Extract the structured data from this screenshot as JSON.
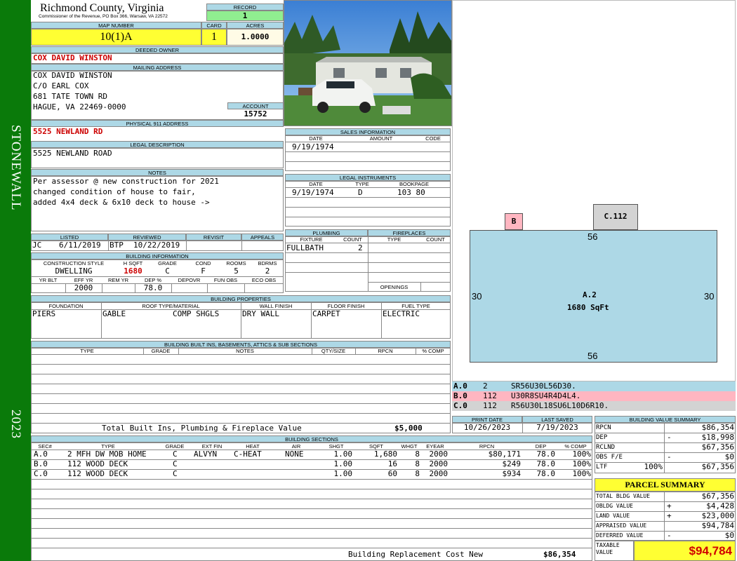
{
  "sidebar": {
    "district": "STONEWALL",
    "year": "2023"
  },
  "header": {
    "county": "Richmond County, Virginia",
    "address": "Commissioner of the Revenue, PO Box 366, Warsaw, VA 22572",
    "record_label": "RECORD",
    "record": "1"
  },
  "map": {
    "map_label": "MAP NUMBER",
    "map_number": "10(1)A",
    "card_label": "CARD",
    "card": "1",
    "acres_label": "ACRES",
    "acres": "1.0000"
  },
  "owner": {
    "deeded_label": "DEEDED OWNER",
    "deeded": "COX DAVID WINSTON",
    "mailing_label": "MAILING ADDRESS",
    "mailing": [
      "COX DAVID WINSTON",
      "C/O EARL COX",
      "681 TATE TOWN RD",
      "HAGUE, VA 22469-0000"
    ],
    "account_label": "ACCOUNT",
    "account": "15752"
  },
  "physical": {
    "label": "PHYSICAL 911 ADDRESS",
    "value": "5525 NEWLAND RD"
  },
  "legal": {
    "label": "LEGAL DESCRIPTION",
    "value": "5525 NEWLAND ROAD"
  },
  "notes": {
    "label": "NOTES",
    "lines": [
      "Per assessor @ new construction for 2021",
      "changed condition of house to fair,",
      "added 4x4 deck & 6x10 deck to house ->"
    ]
  },
  "listing": {
    "listed_label": "LISTED",
    "listed_by": "JC",
    "listed_date": "6/11/2019",
    "reviewed_label": "REVIEWED",
    "reviewed_by": "BTP",
    "reviewed_date": "10/22/2019",
    "revisit_label": "REVISIT",
    "appeals_label": "APPEALS"
  },
  "building_info": {
    "label": "BUILDING INFORMATION",
    "h": [
      "CONSTRUCTION STYLE",
      "H SQFT",
      "GRADE",
      "COND",
      "ROOMS",
      "BDRMS"
    ],
    "v": [
      "DWELLING",
      "1680",
      "C",
      "F",
      "5",
      "2"
    ],
    "h2": [
      "YR BLT",
      "EFF YR",
      "REM YR",
      "DEP %",
      "DEPOVR",
      "FUN OBS",
      "ECO OBS"
    ],
    "v2": [
      "",
      "2000",
      "",
      "78.0",
      "",
      "",
      ""
    ]
  },
  "sales": {
    "label": "SALES INFORMATION",
    "h": [
      "DATE",
      "AMOUNT",
      "CODE"
    ],
    "date": "9/19/1974"
  },
  "instruments": {
    "label": "LEGAL INSTRUMENTS",
    "h": [
      "DATE",
      "TYPE",
      "BOOKPAGE"
    ],
    "date": "9/19/1974",
    "type": "D",
    "book": "103 80"
  },
  "plumbing": {
    "label": "PLUMBING",
    "h": [
      "FIXTURE",
      "COUNT"
    ],
    "fixture": "FULLBATH",
    "count": "2"
  },
  "fireplaces": {
    "label": "FIREPLACES",
    "h": [
      "TYPE",
      "COUNT"
    ],
    "openings": "OPENINGS"
  },
  "properties": {
    "label": "BUILDING PROPERTIES",
    "h": [
      "FOUNDATION",
      "ROOF TYPE/MATERIAL",
      "WALL FINISH",
      "FLOOR FINISH",
      "FUEL TYPE"
    ],
    "foundation": "PIERS",
    "roof_type": "GABLE",
    "roof_mat": "COMP SHGLS",
    "wall": "DRY WALL",
    "floor": "CARPET",
    "fuel": "ELECTRIC"
  },
  "builtins": {
    "label": "BUILDING BUILT INS, BASEMENTS, ATTICS & SUB SECTIONS",
    "h": [
      "TYPE",
      "GRADE",
      "NOTES",
      "QTY/SIZE",
      "RPCN",
      "% COMP"
    ],
    "total_label": "Total Built Ins, Plumbing & Fireplace Value",
    "total": "$5,000"
  },
  "sections": {
    "label": "BUILDING SECTIONS",
    "h": [
      "SEC#",
      "TYPE",
      "GRADE",
      "EXT FIN",
      "HEAT",
      "AIR",
      "SHGT",
      "SQFT",
      "WHGT",
      "EYEAR",
      "RPCN",
      "DEP",
      "% COMP"
    ],
    "rows": [
      [
        "A.0",
        "2 MFH DW MOB HOME",
        "C",
        "ALVYN",
        "C-HEAT",
        "NONE",
        "1.00",
        "1,680",
        "8",
        "2000",
        "$80,171",
        "78.0",
        "100%"
      ],
      [
        "B.0",
        "112 WOOD DECK",
        "C",
        "",
        "",
        "",
        "1.00",
        "16",
        "8",
        "2000",
        "$249",
        "78.0",
        "100%"
      ],
      [
        "C.0",
        "112 WOOD DECK",
        "C",
        "",
        "",
        "",
        "1.00",
        "60",
        "8",
        "2000",
        "$934",
        "78.0",
        "100%"
      ]
    ],
    "replacement_label": "Building Replacement Cost New",
    "replacement": "$86,354"
  },
  "sketch": {
    "main_label": "A.2",
    "main_area": "1680 SqFt",
    "top": "56",
    "bottom": "56",
    "left": "30",
    "right": "30",
    "deck_b": "B",
    "deck_c": "C.112",
    "legend": [
      {
        "sec": "A.0",
        "code": "2",
        "vectors": "SR56U30L56D30.",
        "color": "#add8e6"
      },
      {
        "sec": "B.0",
        "code": "112",
        "vectors": "U30R8SU4R4D4L4.",
        "color": "#ffb6c1"
      },
      {
        "sec": "C.0",
        "code": "112",
        "vectors": "R56U30L18SU6L10D6R10.",
        "color": "#d3d3d3"
      }
    ]
  },
  "dates": {
    "print_label": "PRINT DATE",
    "print": "10/26/2023",
    "saved_label": "LAST SAVED",
    "saved": "7/19/2023"
  },
  "value_summary": {
    "label": "BUILDING VALUE SUMMARY",
    "rows": [
      {
        "k": "RPCN",
        "op": "",
        "v": "$86,354"
      },
      {
        "k": "DEP",
        "op": "-",
        "v": "$18,998"
      },
      {
        "k": "RCLND",
        "op": "",
        "v": "$67,356"
      },
      {
        "k": "OBS F/E",
        "op": "-",
        "v": "$0"
      },
      {
        "k": "LTF",
        "op": "100%",
        "v": "$67,356"
      }
    ]
  },
  "parcel": {
    "label": "PARCEL SUMMARY",
    "rows": [
      {
        "k": "TOTAL BLDG VALUE",
        "op": "",
        "v": "$67,356"
      },
      {
        "k": "OBLDG VALUE",
        "op": "+",
        "v": "$4,428"
      },
      {
        "k": "LAND VALUE",
        "op": "+",
        "v": "$23,000"
      },
      {
        "k": "APPRAISED VALUE",
        "op": "",
        "v": "$94,784"
      },
      {
        "k": "DEFERRED VALUE",
        "op": "-",
        "v": "$0"
      }
    ],
    "taxable_label": "TAXABLE VALUE",
    "taxable": "$94,784"
  }
}
